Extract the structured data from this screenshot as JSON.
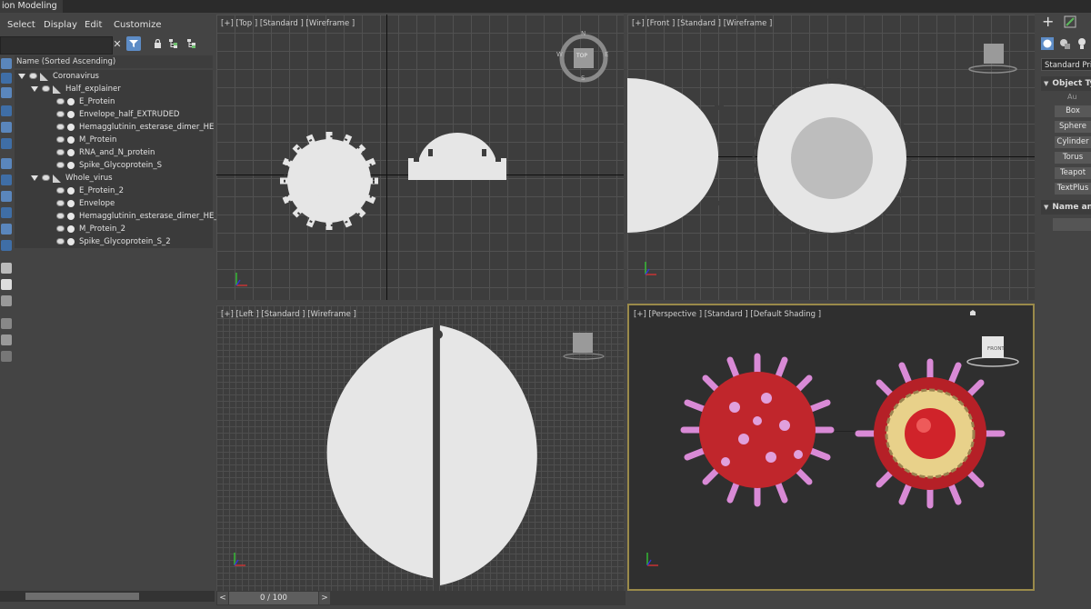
{
  "app": {
    "ribbon_tab": "ion Modeling"
  },
  "explorer": {
    "menu": [
      "Select",
      "Display",
      "Edit",
      "Customize"
    ],
    "search": {
      "placeholder": ""
    },
    "sort_header": "Name (Sorted Ascending)",
    "tree": [
      {
        "label": "Coronavirus",
        "level": 0,
        "expanded": true,
        "kind": "group"
      },
      {
        "label": "Half_explainer",
        "level": 1,
        "expanded": true,
        "kind": "group"
      },
      {
        "label": "E_Protein",
        "level": 2,
        "kind": "object"
      },
      {
        "label": "Envelope_half_EXTRUDED",
        "level": 2,
        "kind": "object"
      },
      {
        "label": "Hemagglutinin_esterase_dimer_HE",
        "level": 2,
        "kind": "object"
      },
      {
        "label": "M_Protein",
        "level": 2,
        "kind": "object"
      },
      {
        "label": "RNA_and_N_protein",
        "level": 2,
        "kind": "object"
      },
      {
        "label": "Spike_Glycoprotein_S",
        "level": 2,
        "kind": "object"
      },
      {
        "label": "Whole_virus",
        "level": 1,
        "expanded": true,
        "kind": "group"
      },
      {
        "label": "E_Protein_2",
        "level": 2,
        "kind": "object"
      },
      {
        "label": "Envelope",
        "level": 2,
        "kind": "object"
      },
      {
        "label": "Hemagglutinin_esterase_dimer_HE_2",
        "level": 2,
        "kind": "object"
      },
      {
        "label": "M_Protein_2",
        "level": 2,
        "kind": "object"
      },
      {
        "label": "Spike_Glycoprotein_S_2",
        "level": 2,
        "kind": "object"
      }
    ]
  },
  "viewports": {
    "top": {
      "label": "[+] [Top ] [Standard ] [Wireframe ]",
      "compass": {
        "n": "N",
        "s": "S",
        "e": "E",
        "w": "W",
        "cube": "TOP"
      }
    },
    "front": {
      "label": "[+] [Front ] [Standard ] [Wireframe ]"
    },
    "left": {
      "label": "[+] [Left ] [Standard ] [Wireframe ]"
    },
    "persp": {
      "label": "[+] [Perspective ] [Standard ] [Default Shading ]",
      "cube": "FRONT"
    }
  },
  "command_panel": {
    "dropdown": "Standard Prim",
    "section_object_type": "Object Ty",
    "autogrid": "Au",
    "buttons": [
      "Box",
      "Sphere",
      "Cylinder",
      "Torus",
      "Teapot",
      "TextPlus"
    ],
    "section_name": "Name and"
  },
  "timeline": {
    "value": "0 / 100",
    "prev": "<",
    "next": ">"
  },
  "colors": {
    "accent": "#5d8cc6",
    "active_border": "#9a8a4a",
    "virus_red": "#c0262c",
    "virus_pink": "#d98ad6",
    "wire_white": "#e6e6e6"
  }
}
